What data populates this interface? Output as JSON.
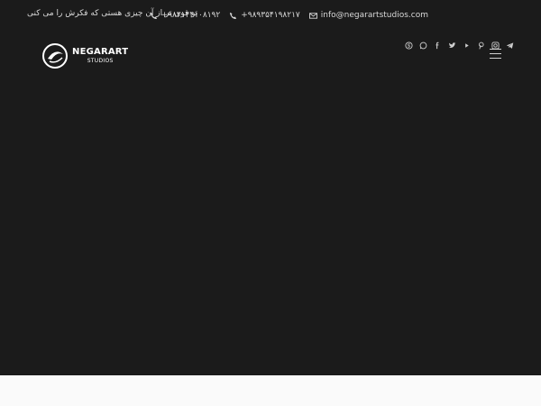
{
  "topbar": {
    "email": "info@negarartstudios.com",
    "phone1": "+۹۸۹۳۵۴۱۹۸۲۱۷",
    "phone2": "+۹۸۲۱۴۴۱۰۸۱۹۲",
    "slogan": "تو قوی تر از آن چیزی هستی که فکرش را می کنی"
  },
  "logo": {
    "line1": "NEGARART",
    "line2": "STUDIOS"
  },
  "socials": [
    "skype-icon",
    "whatsapp-icon",
    "facebook-icon",
    "twitter-icon",
    "youtube-icon",
    "pinterest-icon",
    "instagram-icon",
    "telegram-icon"
  ],
  "colors": {
    "hero_bg": "#1b1b1b",
    "text": "#d9d9d9",
    "page_bg": "#f7f7f7"
  }
}
